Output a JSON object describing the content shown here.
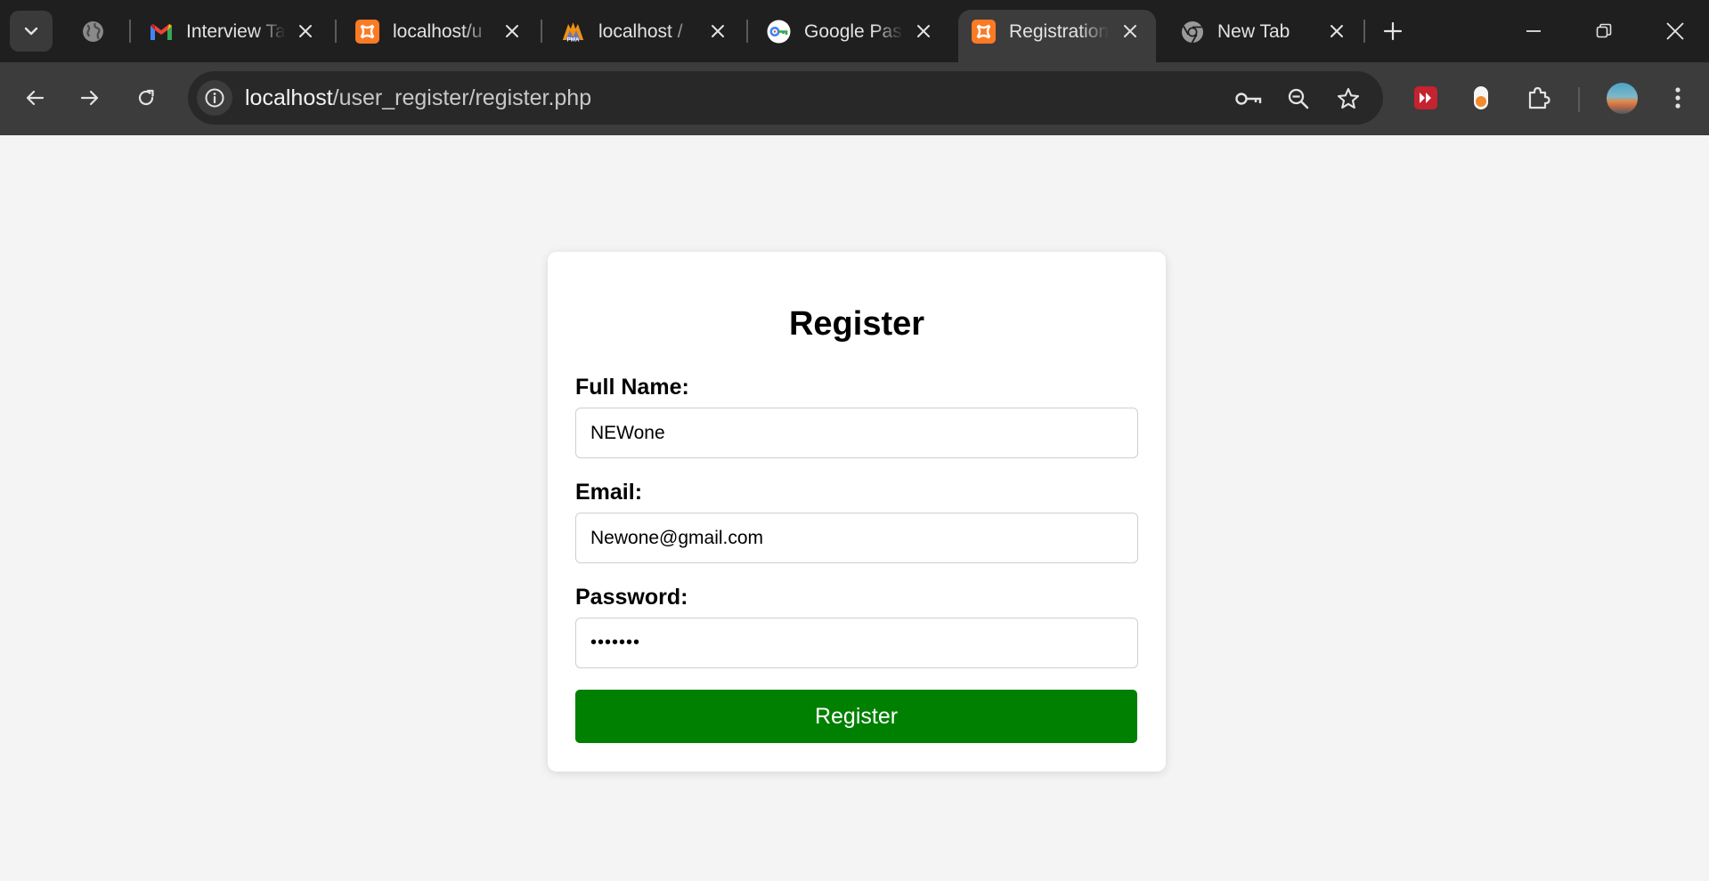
{
  "browser": {
    "tabs": [
      {
        "title": "",
        "favicon": "globe-icon",
        "closable": false
      },
      {
        "title": "Interview Ta",
        "favicon": "gmail-icon"
      },
      {
        "title": "localhost/u",
        "favicon": "xampp-icon"
      },
      {
        "title": "localhost / ",
        "favicon": "phpmyadmin-icon"
      },
      {
        "title": "Google Pas",
        "favicon": "google-password-manager-icon"
      },
      {
        "title": "Registration",
        "favicon": "xampp-icon",
        "active": true
      },
      {
        "title": "New Tab",
        "favicon": "chrome-icon"
      }
    ],
    "new_tab_icon": "plus-icon",
    "window_controls": [
      "minimize-icon",
      "restore-icon",
      "close-icon"
    ],
    "url_host": "localhost",
    "url_path": "/user_register/register.php",
    "omnibox_icons": [
      "key-icon",
      "zoom-out-icon",
      "star-icon"
    ],
    "extensions": [
      "red-extension-icon",
      "orange-toggle-extension-icon",
      "puzzle-icon"
    ],
    "menu_icon": "kebab-menu-icon"
  },
  "form": {
    "title": "Register",
    "fullname_label": "Full Name:",
    "fullname_value": "NEWone",
    "email_label": "Email:",
    "email_value": "Newone@gmail.com",
    "password_label": "Password:",
    "password_value": "•••••••",
    "submit_label": "Register"
  },
  "colors": {
    "submit_button": "#008000",
    "page_background": "#f4f4f4",
    "tab_bar": "#1f1f1f",
    "toolbar": "#3c3c3c",
    "xampp_orange": "#fb7a24"
  }
}
